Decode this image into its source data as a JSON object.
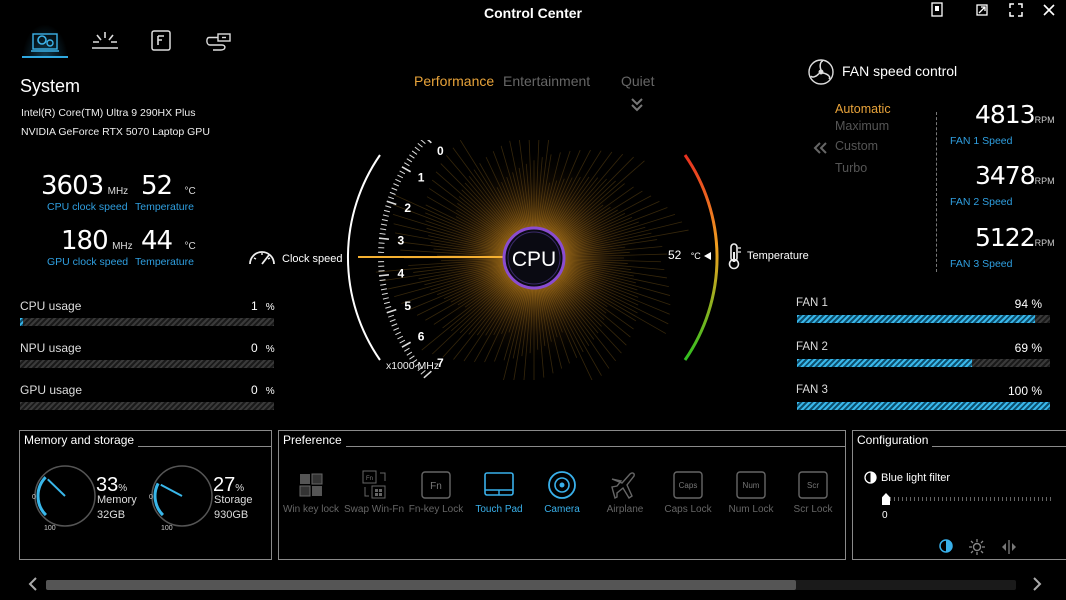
{
  "app": {
    "title": "Control Center"
  },
  "system": {
    "title": "System",
    "cpu_name": "Intel(R) Core(TM) Ultra 9 290HX Plus",
    "gpu_name": "NVIDIA GeForce RTX 5070 Laptop GPU",
    "cpu_clock": "3603",
    "cpu_clock_unit": "MHz",
    "cpu_clock_label": "CPU clock speed",
    "cpu_temp": "52",
    "cpu_temp_unit": "°C",
    "cpu_temp_label": "Temperature",
    "gpu_clock": "180",
    "gpu_clock_unit": "MHz",
    "gpu_clock_label": "GPU clock speed",
    "gpu_temp": "44",
    "gpu_temp_unit": "°C",
    "gpu_temp_label": "Temperature"
  },
  "usage": [
    {
      "label": "CPU usage",
      "value": "1",
      "unit": "%",
      "fraction": 0.01
    },
    {
      "label": "NPU usage",
      "value": "0",
      "unit": "%",
      "fraction": 0.0
    },
    {
      "label": "GPU usage",
      "value": "0",
      "unit": "%",
      "fraction": 0.0
    }
  ],
  "modes": {
    "performance": "Performance",
    "entertainment": "Entertainment",
    "quiet": "Quiet"
  },
  "gauge": {
    "center_label": "CPU",
    "clock_label": "Clock speed",
    "ticks": [
      "7",
      "6",
      "5",
      "4",
      "3",
      "2",
      "1",
      "0"
    ],
    "scale_unit": "x1000 MHz",
    "clock_value_khz": 3.6,
    "temp_value": "52",
    "temp_unit": "°C",
    "temp_label": "Temperature"
  },
  "fan": {
    "title": "FAN speed control",
    "modes": [
      "Automatic",
      "Maximum",
      "Custom",
      "Turbo"
    ],
    "active_mode": "Automatic",
    "speeds": [
      {
        "value": "4813",
        "unit": "RPM",
        "label": "FAN 1 Speed"
      },
      {
        "value": "3478",
        "unit": "RPM",
        "label": "FAN 2 Speed"
      },
      {
        "value": "5122",
        "unit": "RPM",
        "label": "FAN 3 Speed"
      }
    ],
    "bars": [
      {
        "label": "FAN 1",
        "value": "94 %",
        "fraction": 0.94
      },
      {
        "label": "FAN 2",
        "value": "69 %",
        "fraction": 0.69
      },
      {
        "label": "FAN 3",
        "value": "100 %",
        "fraction": 1.0
      }
    ]
  },
  "memory": {
    "title": "Memory and storage",
    "mem_pct": "33",
    "pct_unit": "%",
    "mem_label": "Memory",
    "mem_size": "32GB",
    "mem_fraction": 0.33,
    "sto_pct": "27",
    "sto_label": "Storage",
    "sto_size": "930GB",
    "sto_fraction": 0.27,
    "dial_min": "0",
    "dial_max": "100"
  },
  "preference": {
    "title": "Preference",
    "items": [
      {
        "label": "Win key lock",
        "on": false
      },
      {
        "label": "Swap Win-Fn",
        "on": false
      },
      {
        "label": "Fn-key Lock",
        "on": false
      },
      {
        "label": "Touch Pad",
        "on": true
      },
      {
        "label": "Camera",
        "on": true
      },
      {
        "label": "Airplane",
        "on": false
      },
      {
        "label": "Caps Lock",
        "on": false
      },
      {
        "label": "Num Lock",
        "on": false
      },
      {
        "label": "Scr Lock",
        "on": false
      }
    ],
    "key_caps": {
      "fn": "Fn",
      "caps": "Caps",
      "num": "Num",
      "scr": "Scr",
      "fn_small": "Fn"
    }
  },
  "configuration": {
    "title": "Configuration",
    "blue_light_label": "Blue light filter",
    "blue_light_value": "0"
  },
  "colors": {
    "accent_blue": "#2f9fe0",
    "accent_orange": "#f5a623",
    "active_mode": "#e8a33a"
  },
  "icons": [
    "system-settings-icon",
    "lighting-icon",
    "function-key-icon",
    "usb-icon",
    "print-icon",
    "restore-icon",
    "fullscreen-icon",
    "close-icon",
    "fan-icon",
    "gauge-icon",
    "thermometer-icon"
  ]
}
